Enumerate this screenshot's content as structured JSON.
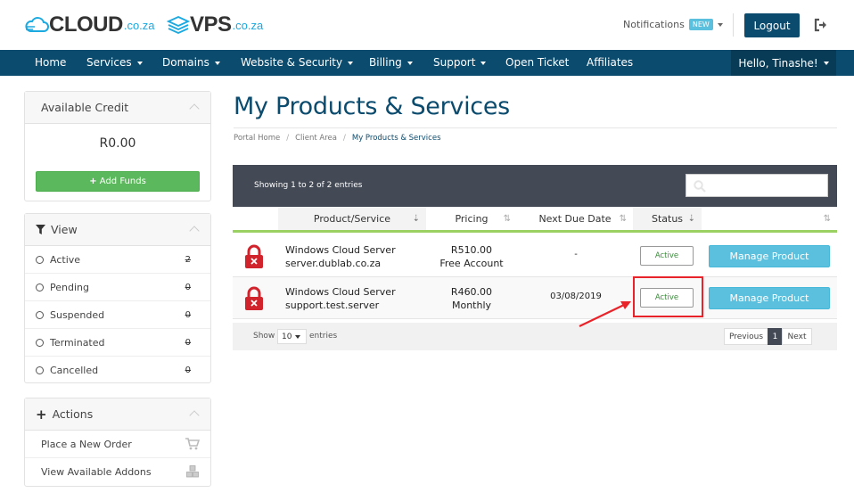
{
  "header": {
    "logo1": {
      "main": "CLOUD",
      "sub": ".co.za"
    },
    "logo2": {
      "main": "VPS",
      "sub": ".co.za"
    },
    "notifications_label": "Notifications",
    "notifications_badge": "NEW",
    "logout_label": "Logout"
  },
  "nav": {
    "items": [
      {
        "label": "Home",
        "dropdown": false
      },
      {
        "label": "Services",
        "dropdown": true
      },
      {
        "label": "Domains",
        "dropdown": true
      },
      {
        "label": "Website & Security",
        "dropdown": true
      },
      {
        "label": "Billing",
        "dropdown": true
      },
      {
        "label": "Support",
        "dropdown": true
      },
      {
        "label": "Open Ticket",
        "dropdown": false
      },
      {
        "label": "Affiliates",
        "dropdown": false
      }
    ],
    "user_label": "Hello, Tinashe!"
  },
  "sidebar": {
    "credit": {
      "title": "Available Credit",
      "amount": "R0.00",
      "add_funds_label": "Add Funds"
    },
    "view": {
      "title": "View",
      "items": [
        {
          "label": "Active",
          "count": "2"
        },
        {
          "label": "Pending",
          "count": "0"
        },
        {
          "label": "Suspended",
          "count": "0"
        },
        {
          "label": "Terminated",
          "count": "0"
        },
        {
          "label": "Cancelled",
          "count": "0"
        }
      ]
    },
    "actions": {
      "title": "Actions",
      "items": [
        {
          "label": "Place a New Order",
          "icon": "cart-icon"
        },
        {
          "label": "View Available Addons",
          "icon": "cubes-icon"
        }
      ]
    }
  },
  "main": {
    "title": "My Products & Services",
    "breadcrumb": [
      "Portal Home",
      "Client Area",
      "My Products & Services"
    ],
    "showing_text": "Showing 1 to 2 of 2 entries",
    "columns": [
      "Product/Service",
      "Pricing",
      "Next Due Date",
      "Status"
    ],
    "rows": [
      {
        "product": "Windows Cloud Server",
        "domain": "server.dublab.co.za",
        "price": "R510.00",
        "cycle": "Free Account",
        "due": "-",
        "status": "Active",
        "action": "Manage Product"
      },
      {
        "product": "Windows Cloud Server",
        "domain": "support.test.server",
        "price": "R460.00",
        "cycle": "Monthly",
        "due": "03/08/2019",
        "status": "Active",
        "action": "Manage Product"
      }
    ],
    "footer": {
      "show_label": "Show",
      "show_value": "10",
      "entries_label": "entries",
      "prev": "Previous",
      "page": "1",
      "next": "Next"
    }
  },
  "colors": {
    "navy": "#0b4b6e",
    "accent": "#1ba9e0",
    "green": "#5cb85c",
    "info": "#5bc0de",
    "highlight": "#e8242a"
  }
}
